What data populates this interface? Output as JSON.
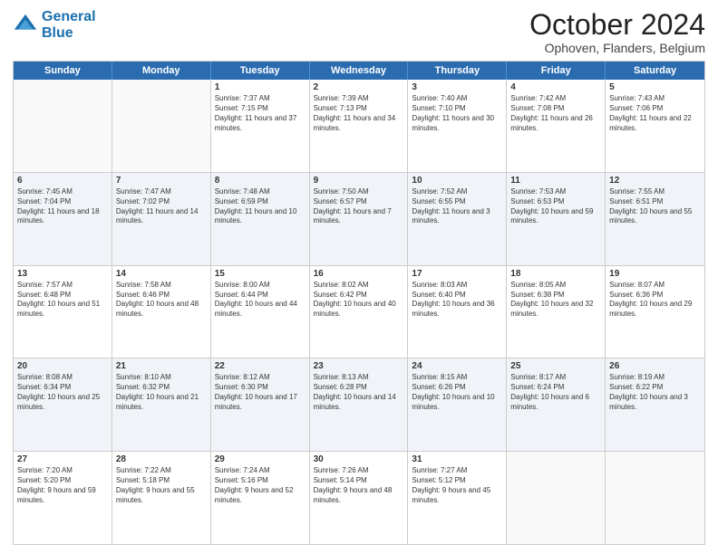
{
  "logo": {
    "line1": "General",
    "line2": "Blue"
  },
  "title": {
    "month_year": "October 2024",
    "location": "Ophoven, Flanders, Belgium"
  },
  "days_of_week": [
    "Sunday",
    "Monday",
    "Tuesday",
    "Wednesday",
    "Thursday",
    "Friday",
    "Saturday"
  ],
  "rows": [
    {
      "cells": [
        {
          "day": "",
          "empty": true
        },
        {
          "day": "",
          "empty": true
        },
        {
          "day": "1",
          "sunrise": "Sunrise: 7:37 AM",
          "sunset": "Sunset: 7:15 PM",
          "daylight": "Daylight: 11 hours and 37 minutes."
        },
        {
          "day": "2",
          "sunrise": "Sunrise: 7:39 AM",
          "sunset": "Sunset: 7:13 PM",
          "daylight": "Daylight: 11 hours and 34 minutes."
        },
        {
          "day": "3",
          "sunrise": "Sunrise: 7:40 AM",
          "sunset": "Sunset: 7:10 PM",
          "daylight": "Daylight: 11 hours and 30 minutes."
        },
        {
          "day": "4",
          "sunrise": "Sunrise: 7:42 AM",
          "sunset": "Sunset: 7:08 PM",
          "daylight": "Daylight: 11 hours and 26 minutes."
        },
        {
          "day": "5",
          "sunrise": "Sunrise: 7:43 AM",
          "sunset": "Sunset: 7:06 PM",
          "daylight": "Daylight: 11 hours and 22 minutes."
        }
      ]
    },
    {
      "alt": true,
      "cells": [
        {
          "day": "6",
          "sunrise": "Sunrise: 7:45 AM",
          "sunset": "Sunset: 7:04 PM",
          "daylight": "Daylight: 11 hours and 18 minutes."
        },
        {
          "day": "7",
          "sunrise": "Sunrise: 7:47 AM",
          "sunset": "Sunset: 7:02 PM",
          "daylight": "Daylight: 11 hours and 14 minutes."
        },
        {
          "day": "8",
          "sunrise": "Sunrise: 7:48 AM",
          "sunset": "Sunset: 6:59 PM",
          "daylight": "Daylight: 11 hours and 10 minutes."
        },
        {
          "day": "9",
          "sunrise": "Sunrise: 7:50 AM",
          "sunset": "Sunset: 6:57 PM",
          "daylight": "Daylight: 11 hours and 7 minutes."
        },
        {
          "day": "10",
          "sunrise": "Sunrise: 7:52 AM",
          "sunset": "Sunset: 6:55 PM",
          "daylight": "Daylight: 11 hours and 3 minutes."
        },
        {
          "day": "11",
          "sunrise": "Sunrise: 7:53 AM",
          "sunset": "Sunset: 6:53 PM",
          "daylight": "Daylight: 10 hours and 59 minutes."
        },
        {
          "day": "12",
          "sunrise": "Sunrise: 7:55 AM",
          "sunset": "Sunset: 6:51 PM",
          "daylight": "Daylight: 10 hours and 55 minutes."
        }
      ]
    },
    {
      "cells": [
        {
          "day": "13",
          "sunrise": "Sunrise: 7:57 AM",
          "sunset": "Sunset: 6:48 PM",
          "daylight": "Daylight: 10 hours and 51 minutes."
        },
        {
          "day": "14",
          "sunrise": "Sunrise: 7:58 AM",
          "sunset": "Sunset: 6:46 PM",
          "daylight": "Daylight: 10 hours and 48 minutes."
        },
        {
          "day": "15",
          "sunrise": "Sunrise: 8:00 AM",
          "sunset": "Sunset: 6:44 PM",
          "daylight": "Daylight: 10 hours and 44 minutes."
        },
        {
          "day": "16",
          "sunrise": "Sunrise: 8:02 AM",
          "sunset": "Sunset: 6:42 PM",
          "daylight": "Daylight: 10 hours and 40 minutes."
        },
        {
          "day": "17",
          "sunrise": "Sunrise: 8:03 AM",
          "sunset": "Sunset: 6:40 PM",
          "daylight": "Daylight: 10 hours and 36 minutes."
        },
        {
          "day": "18",
          "sunrise": "Sunrise: 8:05 AM",
          "sunset": "Sunset: 6:38 PM",
          "daylight": "Daylight: 10 hours and 32 minutes."
        },
        {
          "day": "19",
          "sunrise": "Sunrise: 8:07 AM",
          "sunset": "Sunset: 6:36 PM",
          "daylight": "Daylight: 10 hours and 29 minutes."
        }
      ]
    },
    {
      "alt": true,
      "cells": [
        {
          "day": "20",
          "sunrise": "Sunrise: 8:08 AM",
          "sunset": "Sunset: 6:34 PM",
          "daylight": "Daylight: 10 hours and 25 minutes."
        },
        {
          "day": "21",
          "sunrise": "Sunrise: 8:10 AM",
          "sunset": "Sunset: 6:32 PM",
          "daylight": "Daylight: 10 hours and 21 minutes."
        },
        {
          "day": "22",
          "sunrise": "Sunrise: 8:12 AM",
          "sunset": "Sunset: 6:30 PM",
          "daylight": "Daylight: 10 hours and 17 minutes."
        },
        {
          "day": "23",
          "sunrise": "Sunrise: 8:13 AM",
          "sunset": "Sunset: 6:28 PM",
          "daylight": "Daylight: 10 hours and 14 minutes."
        },
        {
          "day": "24",
          "sunrise": "Sunrise: 8:15 AM",
          "sunset": "Sunset: 6:26 PM",
          "daylight": "Daylight: 10 hours and 10 minutes."
        },
        {
          "day": "25",
          "sunrise": "Sunrise: 8:17 AM",
          "sunset": "Sunset: 6:24 PM",
          "daylight": "Daylight: 10 hours and 6 minutes."
        },
        {
          "day": "26",
          "sunrise": "Sunrise: 8:19 AM",
          "sunset": "Sunset: 6:22 PM",
          "daylight": "Daylight: 10 hours and 3 minutes."
        }
      ]
    },
    {
      "cells": [
        {
          "day": "27",
          "sunrise": "Sunrise: 7:20 AM",
          "sunset": "Sunset: 5:20 PM",
          "daylight": "Daylight: 9 hours and 59 minutes."
        },
        {
          "day": "28",
          "sunrise": "Sunrise: 7:22 AM",
          "sunset": "Sunset: 5:18 PM",
          "daylight": "Daylight: 9 hours and 55 minutes."
        },
        {
          "day": "29",
          "sunrise": "Sunrise: 7:24 AM",
          "sunset": "Sunset: 5:16 PM",
          "daylight": "Daylight: 9 hours and 52 minutes."
        },
        {
          "day": "30",
          "sunrise": "Sunrise: 7:26 AM",
          "sunset": "Sunset: 5:14 PM",
          "daylight": "Daylight: 9 hours and 48 minutes."
        },
        {
          "day": "31",
          "sunrise": "Sunrise: 7:27 AM",
          "sunset": "Sunset: 5:12 PM",
          "daylight": "Daylight: 9 hours and 45 minutes."
        },
        {
          "day": "",
          "empty": true
        },
        {
          "day": "",
          "empty": true
        }
      ]
    }
  ]
}
